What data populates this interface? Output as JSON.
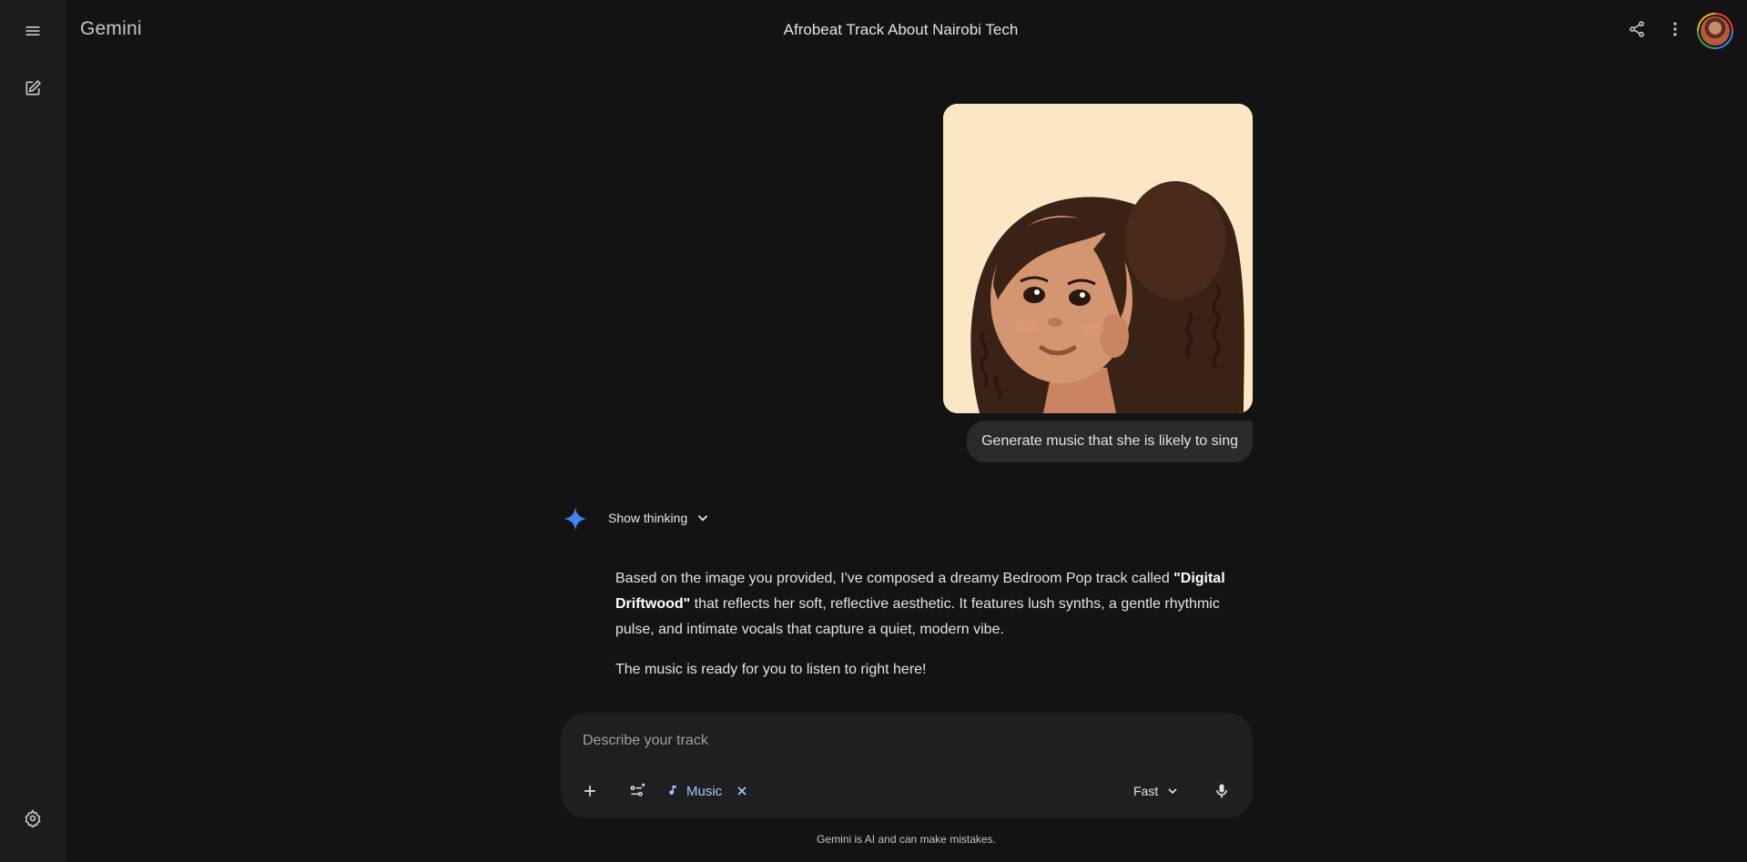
{
  "app": {
    "brand": "Gemini"
  },
  "header": {
    "title": "Afrobeat Track About Nairobi Tech"
  },
  "rail": {
    "menu_icon": "menu-icon",
    "new_chat_icon": "edit-icon",
    "settings_icon": "settings-icon"
  },
  "top_actions": {
    "share_icon": "share-icon",
    "more_icon": "more-vert-icon"
  },
  "conversation": {
    "user_prompt": "Generate music that she is likely to sing",
    "thinking_label": "Show thinking",
    "response": {
      "p1_a": "Based on the image you provided, I've composed a dreamy Bedroom Pop track called ",
      "p1_bold": "\"Digital Driftwood\"",
      "p1_b": " that reflects her soft, reflective aesthetic. It features lush synths, a gentle rhythmic pulse, and intimate vocals that capture a quiet, modern vibe.",
      "p2": "The music is ready for you to listen to right here!"
    }
  },
  "composer": {
    "placeholder": "Describe your track",
    "value": "",
    "chip_label": "Music",
    "model_label": "Fast"
  },
  "footer": {
    "disclaimer": "Gemini is AI and can make mistakes."
  },
  "colors": {
    "background": "#131314",
    "rail": "#1b1c1d",
    "surface": "#1e1f20",
    "bubble": "#282a2c",
    "accent": "#a8c7fa",
    "spark": "#4285f4"
  }
}
